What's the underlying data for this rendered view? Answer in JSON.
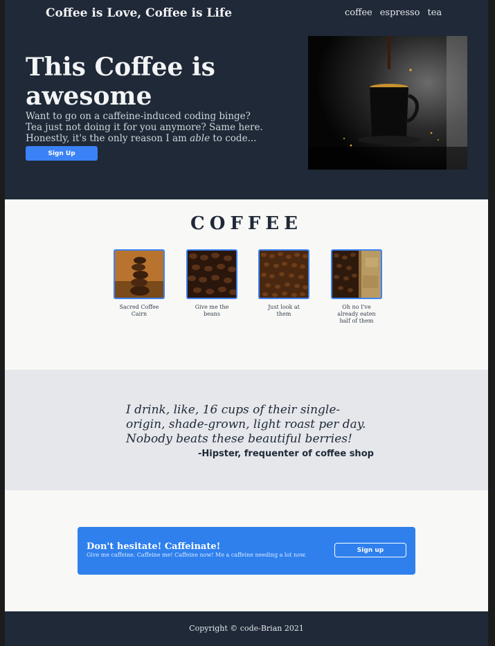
{
  "header": {
    "brand": "Coffee is Love, Coffee is Life",
    "nav": [
      "coffee",
      "espresso",
      "tea"
    ]
  },
  "hero": {
    "title": "This Coffee is awesome",
    "text_before": "Want to go on a caffeine-induced coding binge? Tea just not doing it for you anymore? Same here. Honestly, it's the only reason I am ",
    "text_emphasis": "able",
    "text_after": " to code...",
    "button": "Sign Up"
  },
  "coffee_section": {
    "title": "COFFEE",
    "items": [
      {
        "caption": "Sacred Coffee Cairn"
      },
      {
        "caption": "Give me the beans"
      },
      {
        "caption": "Just look at them"
      },
      {
        "caption": "Oh no I've already eaten half of them"
      }
    ]
  },
  "quote": {
    "text": "I drink, like, 16 cups of their single-origin, shade-grown, light roast per day. Nobody beats these beautiful berries!",
    "author": "-Hipster, frequenter of coffee shop"
  },
  "cta": {
    "title": "Don't hesitate! Caffeinate!",
    "text": "Give me caffeine. Caffeine me! Caffeine now! Me a caffeine needing a lot now.",
    "button": "Sign up"
  },
  "footer": {
    "copyright": "Copyright © code-Brian 2021"
  },
  "colors": {
    "dark": "#1f2937",
    "accent": "#3b82f6",
    "light": "#f8f8f6",
    "quote_bg": "#e5e7eb"
  }
}
